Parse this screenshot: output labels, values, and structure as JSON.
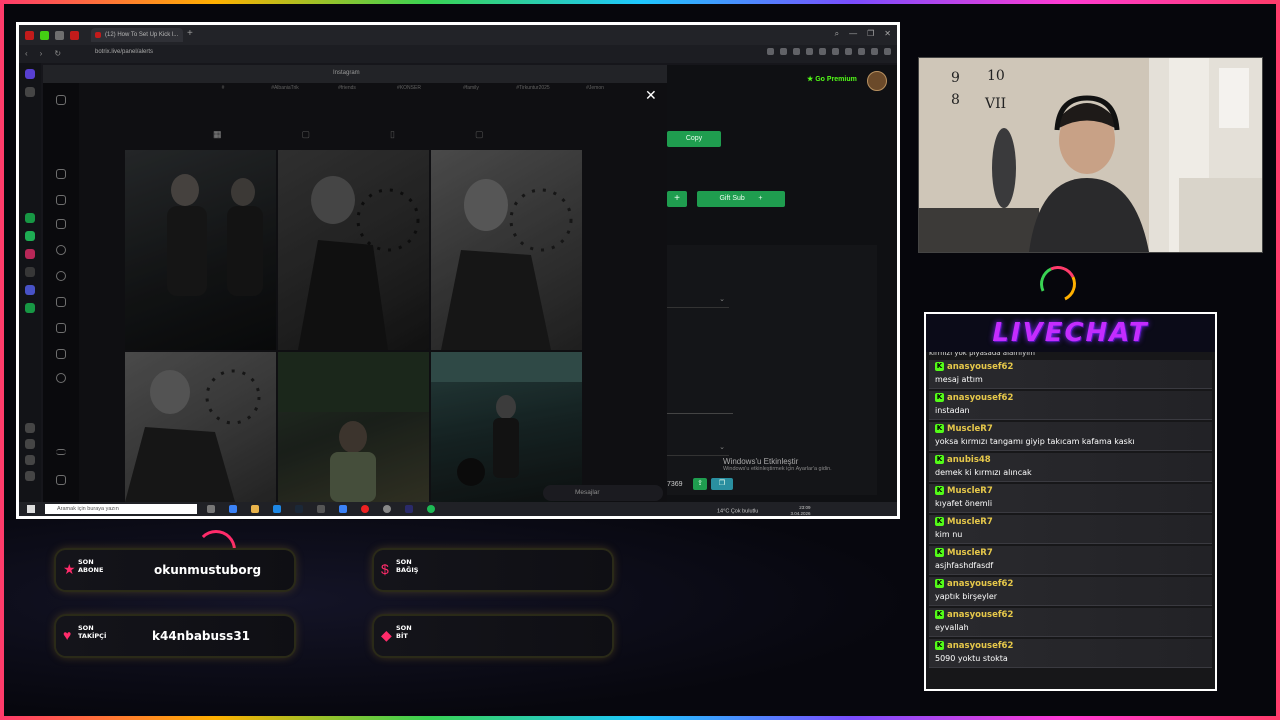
{
  "browser": {
    "tab_title": "(12) How To Set Up Kick l...",
    "url": "botrix.live/panel/alerts",
    "new_tab": "+",
    "window_controls": [
      "⌕",
      "—",
      "❐",
      "✕"
    ]
  },
  "instagram": {
    "window_title": "Instagram",
    "close": "✕",
    "highlights": [
      "#",
      "#AlbaniaTrik",
      "#friends",
      "#KONSER",
      "#family",
      "#Tirkuntur2025",
      "#Jemon"
    ],
    "messages_label": "Mesajlar"
  },
  "kick_panel": {
    "go_premium": "Go Premium",
    "copy_label": "Copy",
    "plus": "+",
    "gift_sub": "Gift Sub",
    "partial_number": "7369"
  },
  "windows_activation": {
    "title": "Windows'u Etkinleştir",
    "subtitle": "Windows'u etkinleştirmek için Ayarlar'a gidin."
  },
  "taskbar": {
    "search_placeholder": "Aramak için buraya yazın",
    "weather": "14°C Çok bulutlu",
    "time": "23:09",
    "date": "3.04.2026"
  },
  "livechat": {
    "title": "LIVECHAT",
    "cut_top": "kırmızı yok piyasada alamıyım",
    "messages": [
      {
        "user": "anasyousef62",
        "text": "mesaj attım"
      },
      {
        "user": "anasyousef62",
        "text": "instadan"
      },
      {
        "user": "MuscleR7",
        "text": "yoksa kırmızı tangamı giyip takıcam kafama kaskı"
      },
      {
        "user": "anubis48",
        "text": "demek ki kırmızı alıncak"
      },
      {
        "user": "MuscleR7",
        "text": "kıyafet önemli"
      },
      {
        "user": "MuscleR7",
        "text": "kim nu"
      },
      {
        "user": "MuscleR7",
        "text": "asjhfashdfasdf"
      },
      {
        "user": "anasyousef62",
        "text": "yaptık birşeyler"
      },
      {
        "user": "anasyousef62",
        "text": "eyvallah"
      },
      {
        "user": "anasyousef62",
        "text": "5090 yoktu stokta"
      }
    ]
  },
  "alerts": {
    "last_sub_label_1": "SON",
    "last_sub_label_2": "ABONE",
    "last_sub_value": "okunmustuborg",
    "last_donation_label_1": "SON",
    "last_donation_label_2": "BAĞIŞ",
    "last_follower_label_1": "SON",
    "last_follower_label_2": "TAKİPÇİ",
    "last_follower_value": "k44nbabuss31",
    "last_bit_label_1": "SON",
    "last_bit_label_2": "BİT"
  },
  "colors": {
    "kick_green": "#53fc18",
    "button_green": "#1f9d4f",
    "username_gold": "#e6c84a",
    "accent_pink": "#ff2b6a"
  }
}
